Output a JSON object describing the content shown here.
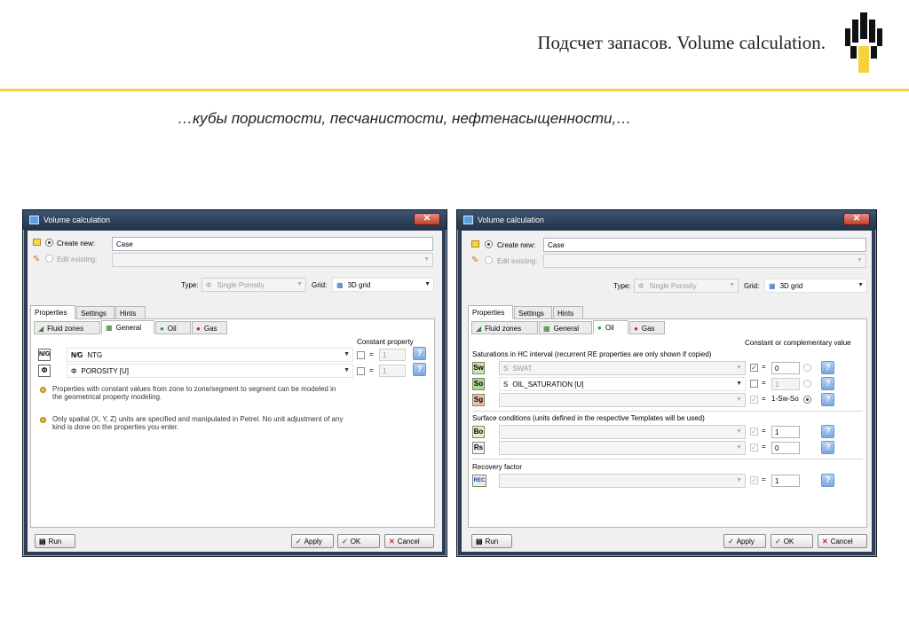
{
  "slide": {
    "title": "Подсчет запасов. Volume calculation.",
    "subtitle": "…кубы пористости, песчанистости, нефтенасыщенности,…",
    "colors": {
      "rule": "#f4d23a",
      "logo_black": "#111111",
      "logo_yellow": "#f4d23a"
    }
  },
  "left_dialog": {
    "title": "Volume calculation",
    "create_new_label": "Create new:",
    "create_new_value": "Case",
    "edit_existing_label": "Edit existing:",
    "type_label": "Type:",
    "type_value": "Single Porosity",
    "grid_label": "Grid:",
    "grid_value": "3D grid",
    "tabs": [
      "Properties",
      "Settings",
      "Hints"
    ],
    "subtabs": [
      "Fluid zones",
      "General",
      "Oil",
      "Gas"
    ],
    "constant_header": "Constant property",
    "properties": [
      {
        "icon": "N/G",
        "name": "NTG",
        "const": "1"
      },
      {
        "icon": "Φ",
        "name": "POROSITY [U]",
        "const": "1"
      }
    ],
    "hints": [
      "Properties with constant values from zone to zone/segment to segment can be modeled in the geometrical property modeling.",
      "Only spatial (X, Y, Z) units are specified and manipulated in Petrel.  No unit adjustment of any kind is done on the properties you enter."
    ],
    "buttons": {
      "run": "Run",
      "apply": "Apply",
      "ok": "OK",
      "cancel": "Cancel"
    }
  },
  "right_dialog": {
    "title": "Volume calculation",
    "create_new_label": "Create new:",
    "create_new_value": "Case",
    "edit_existing_label": "Edit existing:",
    "type_label": "Type:",
    "type_value": "Single Porosity",
    "grid_label": "Grid:",
    "grid_value": "3D grid",
    "tabs": [
      "Properties",
      "Settings",
      "Hints"
    ],
    "subtabs": [
      "Fluid zones",
      "General",
      "Oil",
      "Gas"
    ],
    "constant_header": "Constant or complementary value",
    "sat_group": "Saturations in HC interval (recurrent RE properties are only shown if copied)",
    "sat_rows": [
      {
        "icon": "Sw",
        "name": "SWAT",
        "const": "0"
      },
      {
        "icon": "So",
        "name": "OIL_SATURATION [U]",
        "const": "1"
      },
      {
        "icon": "Sg",
        "name": "",
        "const": "1-Sw-So"
      }
    ],
    "surface_group": "Surface conditions (units defined in the respective Templates will be used)",
    "surface_rows": [
      {
        "icon": "Bo",
        "const": "1"
      },
      {
        "icon": "Rs",
        "const": "0"
      }
    ],
    "recovery_group": "Recovery factor",
    "recovery_row": {
      "icon": "REC",
      "const": "1"
    },
    "buttons": {
      "run": "Run",
      "apply": "Apply",
      "ok": "OK",
      "cancel": "Cancel"
    }
  }
}
